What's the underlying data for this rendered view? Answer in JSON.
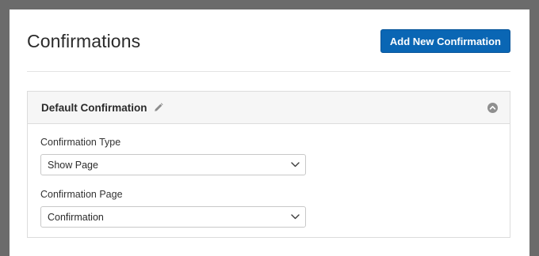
{
  "page": {
    "title": "Confirmations",
    "add_button_label": "Add New Confirmation"
  },
  "card": {
    "title": "Default Confirmation",
    "fields": [
      {
        "label": "Confirmation Type",
        "value": "Show Page"
      },
      {
        "label": "Confirmation Page",
        "value": "Confirmation"
      }
    ]
  },
  "colors": {
    "accent": "#0a66b4",
    "backdrop": "#6b6b6b",
    "card_header_bg": "#f6f6f6"
  },
  "icons": {
    "edit": "pencil-icon",
    "collapse": "chevron-up-circle-icon",
    "select": "chevron-down-icon"
  }
}
